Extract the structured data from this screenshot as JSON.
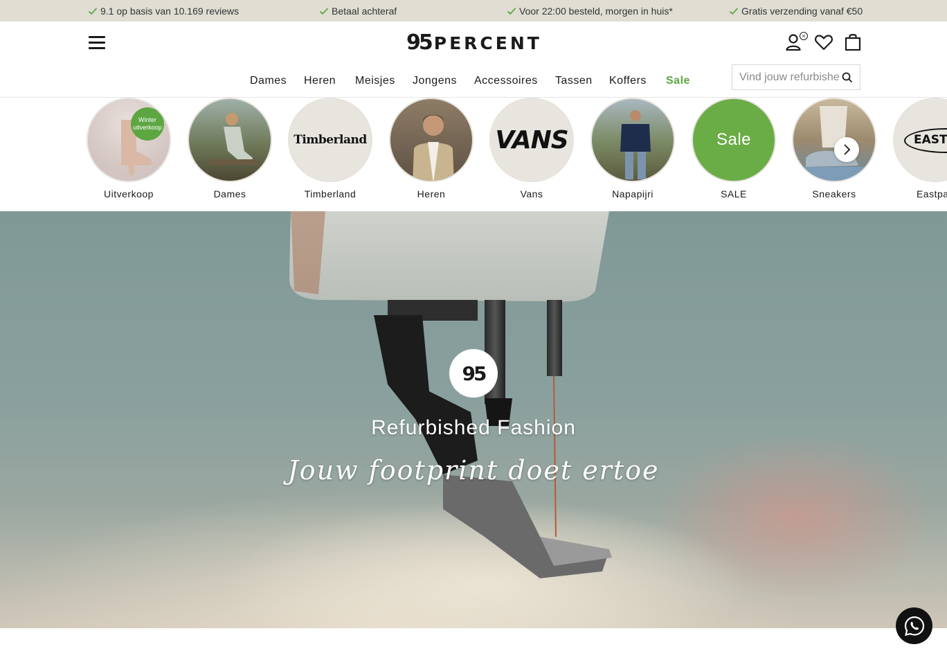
{
  "usp_bar": {
    "items": [
      {
        "text": "9.1 op basis van 10.169 reviews",
        "icon": "check-icon"
      },
      {
        "text": "Betaal achteraf",
        "icon": "check-icon"
      },
      {
        "text": "Voor 22:00 besteld, morgen in huis*",
        "icon": "check-icon"
      },
      {
        "text": "Gratis verzending vanaf €50",
        "icon": "check-icon"
      }
    ],
    "check_color": "#5da642"
  },
  "header": {
    "logo": {
      "mark": "95",
      "text": "PERCENT"
    },
    "account_badge": "×",
    "icons": [
      "menu-icon",
      "account-icon",
      "heart-icon",
      "bag-icon"
    ],
    "search": {
      "placeholder": "Vind jouw refurbished"
    }
  },
  "nav": {
    "items": [
      "Dames",
      "Heren",
      "Meisjes",
      "Jongens",
      "Accessoires",
      "Tassen",
      "Koffers",
      "Sale"
    ],
    "sale_color": "#5da642"
  },
  "categories": {
    "items": [
      {
        "label": "Uitverkoop",
        "badge": "Winter uitverkoop"
      },
      {
        "label": "Dames"
      },
      {
        "label": "Timberland",
        "brand": "Timberland"
      },
      {
        "label": "Heren"
      },
      {
        "label": "Vans",
        "brand": "VANS"
      },
      {
        "label": "Napapijri"
      },
      {
        "label": "SALE",
        "brand": "Sale"
      },
      {
        "label": "Sneakers"
      },
      {
        "label": "Eastpak",
        "brand": "EASTPAK"
      }
    ],
    "next_icon": "chevron-right-icon"
  },
  "hero": {
    "logo_mark": "95",
    "title": "Refurbished Fashion",
    "subtitle": "Jouw footprint doet ertoe"
  },
  "chat": {
    "icon": "whatsapp-icon"
  }
}
